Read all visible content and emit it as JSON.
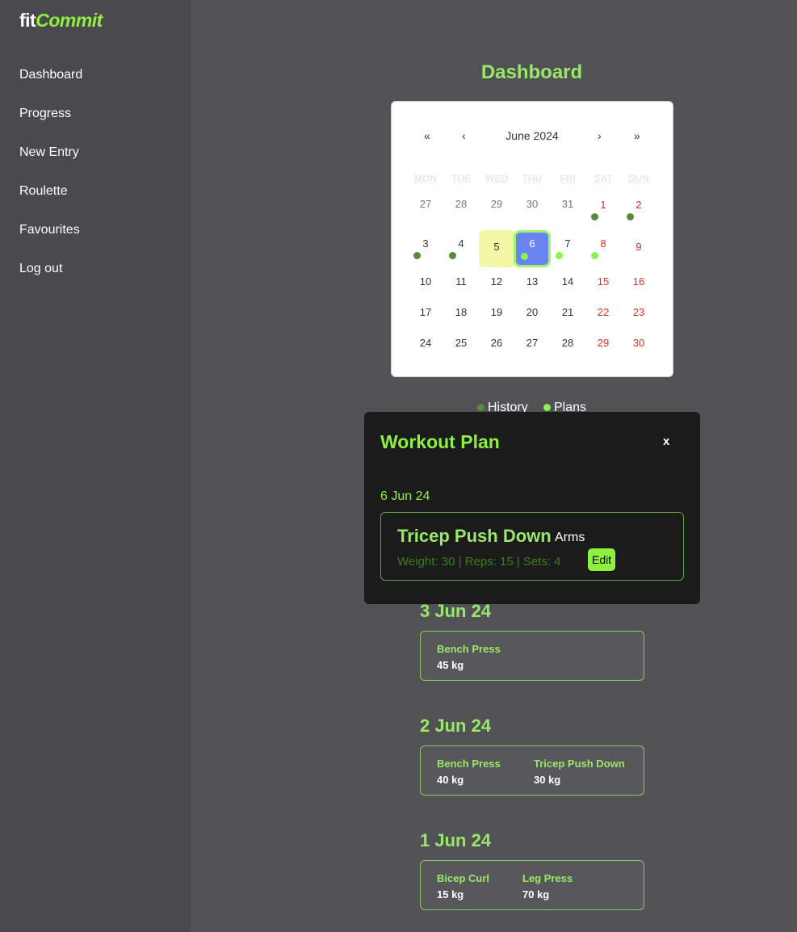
{
  "app": {
    "brand_part1": "fit",
    "brand_part2": "Commit",
    "accent_color": "#8ef13f"
  },
  "sidebar": {
    "items": [
      {
        "label": "Dashboard"
      },
      {
        "label": "Progress"
      },
      {
        "label": "New Entry"
      },
      {
        "label": "Roulette"
      },
      {
        "label": "Favourites"
      },
      {
        "label": "Log out"
      }
    ]
  },
  "page_title": "Dashboard",
  "calendar": {
    "month_label": "June 2024",
    "nav": {
      "first": "«",
      "prev": "‹",
      "next": "›",
      "last": "»"
    },
    "weekdays": [
      "MON",
      "TUE",
      "WED",
      "THU",
      "FRI",
      "SAT",
      "SUN"
    ],
    "weeks": [
      [
        {
          "day": "27",
          "state": "other"
        },
        {
          "day": "28",
          "state": "other"
        },
        {
          "day": "29",
          "state": "other"
        },
        {
          "day": "30",
          "state": "other"
        },
        {
          "day": "31",
          "state": "other"
        },
        {
          "day": "1",
          "state": "weekend",
          "marker": "history"
        },
        {
          "day": "2",
          "state": "weekend",
          "marker": "history"
        }
      ],
      [
        {
          "day": "3",
          "state": "normal",
          "marker": "history"
        },
        {
          "day": "4",
          "state": "normal",
          "marker": "history"
        },
        {
          "day": "5",
          "state": "today"
        },
        {
          "day": "6",
          "state": "selected",
          "marker": "plan"
        },
        {
          "day": "7",
          "state": "normal",
          "marker": "plan"
        },
        {
          "day": "8",
          "state": "weekend",
          "marker": "plan"
        },
        {
          "day": "9",
          "state": "weekend"
        }
      ],
      [
        {
          "day": "10",
          "state": "normal"
        },
        {
          "day": "11",
          "state": "normal"
        },
        {
          "day": "12",
          "state": "normal"
        },
        {
          "day": "13",
          "state": "normal"
        },
        {
          "day": "14",
          "state": "normal"
        },
        {
          "day": "15",
          "state": "weekend"
        },
        {
          "day": "16",
          "state": "weekend"
        }
      ],
      [
        {
          "day": "17",
          "state": "normal"
        },
        {
          "day": "18",
          "state": "normal"
        },
        {
          "day": "19",
          "state": "normal"
        },
        {
          "day": "20",
          "state": "normal"
        },
        {
          "day": "21",
          "state": "normal"
        },
        {
          "day": "22",
          "state": "weekend"
        },
        {
          "day": "23",
          "state": "weekend"
        }
      ],
      [
        {
          "day": "24",
          "state": "normal"
        },
        {
          "day": "25",
          "state": "normal"
        },
        {
          "day": "26",
          "state": "normal"
        },
        {
          "day": "27",
          "state": "normal"
        },
        {
          "day": "28",
          "state": "normal"
        },
        {
          "day": "29",
          "state": "weekend"
        },
        {
          "day": "30",
          "state": "weekend"
        }
      ]
    ],
    "colors": {
      "history_dot": "#5b8a3a",
      "plan_dot": "#8df44d",
      "today_bg": "#f4f7a6",
      "selected_bg": "#6b82f2",
      "weekend_text": "#d0342c"
    }
  },
  "legend": {
    "history": "History",
    "plans": "Plans"
  },
  "history_entries": [
    {
      "date": "3 Jun 24",
      "exercises": [
        {
          "name": "Bench Press",
          "weight": "45 kg"
        }
      ]
    },
    {
      "date": "2 Jun 24",
      "exercises": [
        {
          "name": "Bench Press",
          "weight": "40 kg"
        },
        {
          "name": "Tricep Push Down",
          "weight": "30 kg"
        }
      ]
    },
    {
      "date": "1 Jun 24",
      "exercises": [
        {
          "name": "Bicep Curl",
          "weight": "15 kg"
        },
        {
          "name": "Leg Press",
          "weight": "70 kg"
        }
      ]
    }
  ],
  "modal": {
    "title": "Workout Plan",
    "close_label": "x",
    "date": "6 Jun 24",
    "plan": {
      "exercise": "Tricep Push Down",
      "category": "Arms",
      "details": "Weight: 30 | Reps: 15 | Sets: 4",
      "edit_label": "Edit"
    }
  }
}
